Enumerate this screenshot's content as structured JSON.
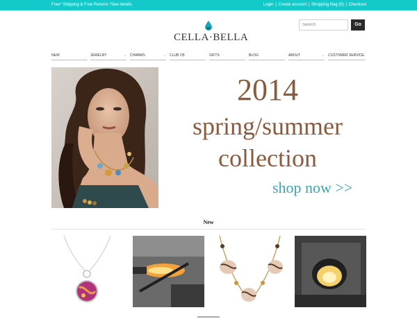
{
  "topbar": {
    "promo": "Free* Shipping & Free Returns *See details",
    "links": [
      "Login",
      "Create account",
      "Shopping Bag (0)",
      "Checkout"
    ],
    "separator": "|",
    "color": "#14c9c9"
  },
  "logo": {
    "text": "CELLA·BELLA",
    "drop_color": "#1aa6b8"
  },
  "search": {
    "placeholder": "Search",
    "button_label": "Go"
  },
  "nav": {
    "items": [
      {
        "label": "New",
        "has_dropdown": false
      },
      {
        "label": "Jewelry",
        "has_dropdown": true
      },
      {
        "label": "Charms",
        "has_dropdown": true
      },
      {
        "label": "Club CB",
        "has_dropdown": false
      },
      {
        "label": "Gifts",
        "has_dropdown": false
      },
      {
        "label": "Blog",
        "has_dropdown": false
      },
      {
        "label": "About",
        "has_dropdown": true
      },
      {
        "label": "Customer Service",
        "has_dropdown": true
      }
    ],
    "dropdown_glyph": "⌄"
  },
  "hero": {
    "year": "2014",
    "season": "spring/summer",
    "collection": "collection",
    "cta": "shop now >>",
    "text_color": "#8a5a3e",
    "cta_color": "#3aa7b0"
  },
  "new_section": {
    "title": "New"
  },
  "products": [
    {
      "icon": "pendant-necklace-image"
    },
    {
      "icon": "glass-torch-image"
    },
    {
      "icon": "beaded-necklace-image"
    },
    {
      "icon": "furnace-image"
    }
  ]
}
